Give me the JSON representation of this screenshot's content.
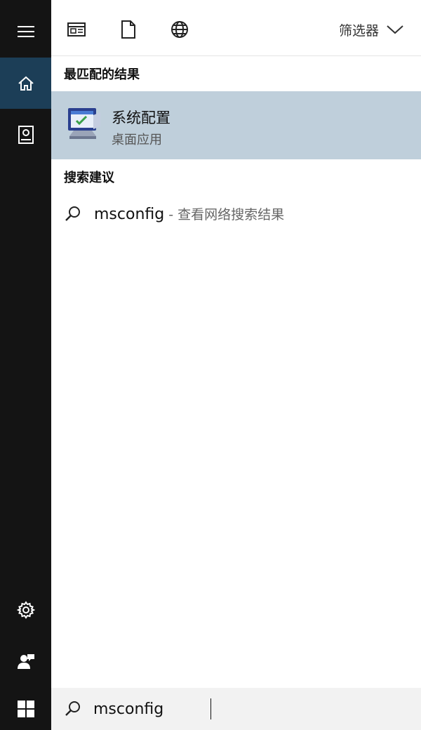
{
  "toolbar": {
    "filter_label": "筛选器",
    "icons": [
      "apps-icon",
      "document-icon",
      "globe-icon"
    ]
  },
  "rail": {
    "icons": [
      "hamburger-menu-icon",
      "home-icon",
      "notebook-icon",
      "settings-gear-icon",
      "user-feedback-icon",
      "windows-start-icon"
    ],
    "active": "home-icon"
  },
  "results": {
    "best_match_heading": "最匹配的结果",
    "best_match": {
      "title": "系统配置",
      "subtitle": "桌面应用",
      "icon": "system-config-monitor-icon"
    },
    "suggestions_heading": "搜索建议",
    "suggestions": [
      {
        "term": "msconfig",
        "hint": " - 查看网络搜索结果"
      }
    ]
  },
  "search": {
    "value": "msconfig"
  },
  "colors": {
    "rail_bg": "#141414",
    "rail_active": "#1c3e57",
    "selection": "#bfcfdb",
    "searchbar_bg": "#f2f2f2"
  }
}
